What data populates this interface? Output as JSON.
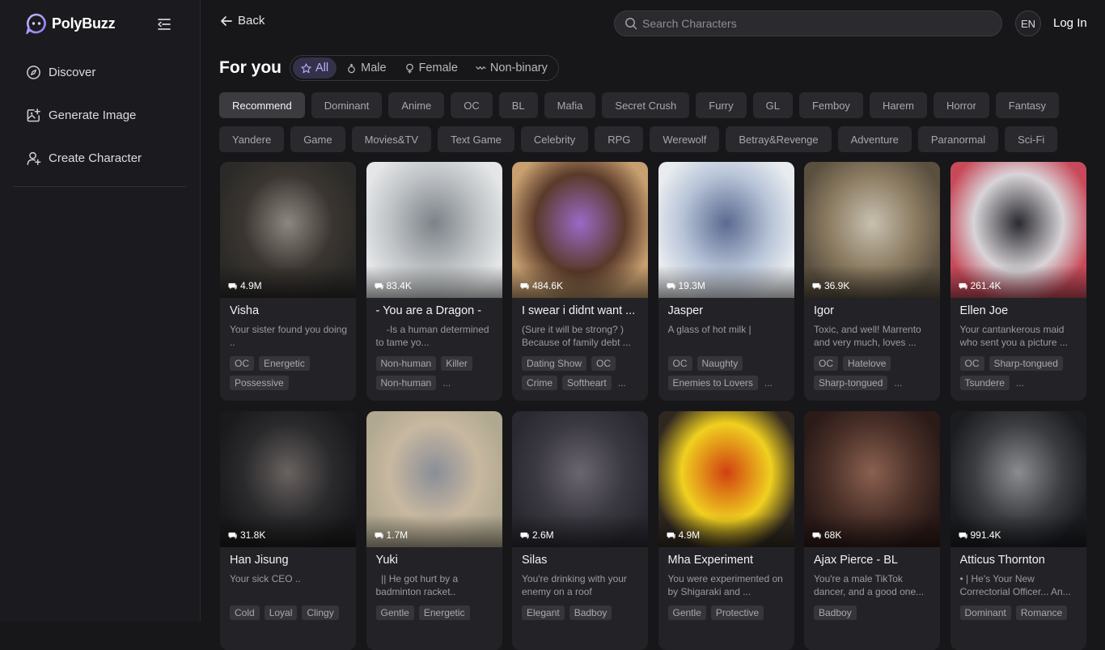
{
  "sidebar": {
    "brand": "PolyBuzz",
    "items": [
      {
        "label": "Discover",
        "icon": "compass-icon"
      },
      {
        "label": "Generate Image",
        "icon": "image-plus-icon"
      },
      {
        "label": "Create Character",
        "icon": "user-plus-icon"
      }
    ]
  },
  "header": {
    "back_label": "Back",
    "search_placeholder": "Search Characters",
    "lang": "EN",
    "login_label": "Log In"
  },
  "main": {
    "title": "For you",
    "gender_filters": [
      {
        "label": "All",
        "icon": "star-icon",
        "active": true
      },
      {
        "label": "Male",
        "icon": "male-icon",
        "active": false
      },
      {
        "label": "Female",
        "icon": "female-icon",
        "active": false
      },
      {
        "label": "Non-binary",
        "icon": "nonbinary-icon",
        "active": false
      }
    ],
    "tags_row1": [
      "Recommend",
      "Dominant",
      "Anime",
      "OC",
      "BL",
      "Mafia",
      "Secret Crush",
      "Furry",
      "GL",
      "Femboy",
      "Harem",
      "Horror",
      "Fantasy"
    ],
    "tags_row2": [
      "Yandere",
      "Game",
      "Movies&TV",
      "Text Game",
      "Celebrity",
      "RPG",
      "Werewolf",
      "Betray&Revenge",
      "Adventure",
      "Paranormal",
      "Sci-Fi"
    ],
    "active_tag": "Recommend"
  },
  "cards": [
    {
      "name": "Visha",
      "count": "4.9M",
      "desc": "Your sister found you doing ..",
      "tags": [
        "OC",
        "Energetic",
        "Possessive"
      ],
      "more": false,
      "colors": [
        "#3a3530",
        "#8c8780",
        "#2b2a28"
      ]
    },
    {
      "name": "- You are a Dragon -",
      "count": "83.4K",
      "desc": "    -Is a human determined to tame yo...",
      "tags": [
        "Non-human",
        "Killer",
        "Non-human"
      ],
      "more": true,
      "colors": [
        "#bfc3c6",
        "#7c8288",
        "#e4e6e7"
      ]
    },
    {
      "name": "I swear i didnt want ...",
      "count": "484.6K",
      "desc": "(Sure it will be strong? ) Because of family debt ...",
      "tags": [
        "Dating Show",
        "OC",
        "Crime",
        "Softheart"
      ],
      "more": true,
      "colors": [
        "#5a3a2a",
        "#9a6ac8",
        "#c8a070"
      ]
    },
    {
      "name": "Jasper",
      "count": "19.3M",
      "desc": "A glass of hot milk |",
      "tags": [
        "OC",
        "Naughty",
        "Enemies to Lovers"
      ],
      "more": true,
      "colors": [
        "#b8c4d8",
        "#5a6a90",
        "#e8ecef"
      ]
    },
    {
      "name": "Igor",
      "count": "36.9K",
      "desc": "Toxic, and well! Marrento and very much, loves ...",
      "tags": [
        "OC",
        "Hatelove",
        "Sharp-tongued"
      ],
      "more": true,
      "colors": [
        "#8a7a60",
        "#c8c0b0",
        "#5a5040"
      ]
    },
    {
      "name": "Ellen Joe",
      "count": "261.4K",
      "desc": "Your cantankerous maid who sent you a picture ...",
      "tags": [
        "OC",
        "Sharp-tongued",
        "Tsundere"
      ],
      "more": true,
      "colors": [
        "#d8d4d8",
        "#2a2a30",
        "#c84a5a"
      ]
    },
    {
      "name": "Han Jisung",
      "count": "31.8K",
      "desc": "Your sick CEO ..",
      "tags": [
        "Cold",
        "Loyal",
        "Clingy"
      ],
      "more": false,
      "colors": [
        "#2a2a2c",
        "#6a6260",
        "#1a1a1c"
      ]
    },
    {
      "name": "Yuki",
      "count": "1.7M",
      "desc": "  || He got hurt by a badminton racket..",
      "tags": [
        "Gentle",
        "Energetic"
      ],
      "more": false,
      "colors": [
        "#c8b8a0",
        "#8a8e98",
        "#b0a890"
      ]
    },
    {
      "name": "Silas",
      "count": "2.6M",
      "desc": "You're drinking with your enemy on a roof",
      "tags": [
        "Elegant",
        "Badboy"
      ],
      "more": false,
      "colors": [
        "#3a3840",
        "#6a6670",
        "#2a2830"
      ]
    },
    {
      "name": "Mha Experiment",
      "count": "4.9M",
      "desc": "You were experimented on by Shigaraki and ...",
      "tags": [
        "Gentle",
        "Protective"
      ],
      "more": false,
      "colors": [
        "#f0d020",
        "#d04010",
        "#302820"
      ]
    },
    {
      "name": "Ajax Pierce - BL",
      "count": "68K",
      "desc": "You're a male TikTok dancer, and a good one...",
      "tags": [
        "Badboy"
      ],
      "more": false,
      "colors": [
        "#4a3028",
        "#8a6050",
        "#2a1a18"
      ]
    },
    {
      "name": "Atticus Thornton",
      "count": "991.4K",
      "desc": "• | He's Your New Correctorial Officer... An...",
      "tags": [
        "Dominant",
        "Romance"
      ],
      "more": false,
      "colors": [
        "#3a3c40",
        "#8a8c90",
        "#1a1c20"
      ]
    }
  ]
}
